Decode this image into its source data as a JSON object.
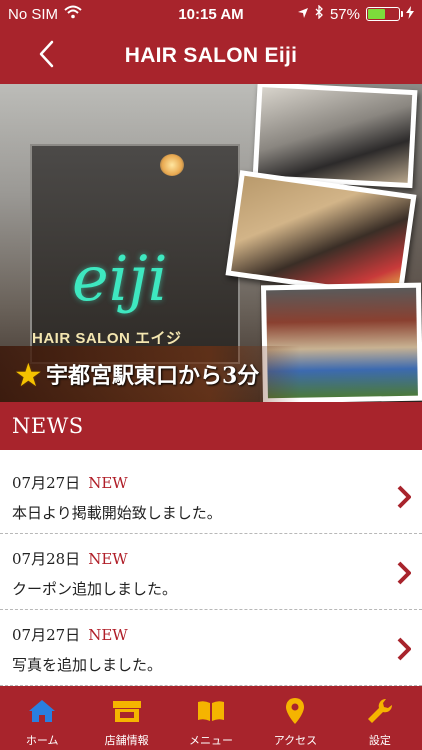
{
  "status_bar": {
    "carrier": "No SIM",
    "time": "10:15 AM",
    "battery_percent": "57%",
    "battery_level": 0.57
  },
  "nav": {
    "title": "HAIR SALON Eiji",
    "back_icon": "chevron-left-icon"
  },
  "hero": {
    "logo_text": "eiji",
    "sign_text": "HAIR SALON エイジ",
    "caption": "宇都宮駅東口から3分",
    "star_icon": "star-icon"
  },
  "news": {
    "header": "NEWS",
    "items": [
      {
        "date": "07月27日",
        "badge": "NEW",
        "text": "本日より掲載開始致しました。"
      },
      {
        "date": "07月28日",
        "badge": "NEW",
        "text": "クーポン追加しました。"
      },
      {
        "date": "07月27日",
        "badge": "NEW",
        "text": "写真を追加しました。"
      }
    ]
  },
  "tabs": [
    {
      "label": "ホーム",
      "icon": "home-icon",
      "color": "#2a7fe0"
    },
    {
      "label": "店舗情報",
      "icon": "shop-icon",
      "color": "#f5b400"
    },
    {
      "label": "メニュー",
      "icon": "book-icon",
      "color": "#f5b400"
    },
    {
      "label": "アクセス",
      "icon": "map-pin-icon",
      "color": "#f5b400"
    },
    {
      "label": "設定",
      "icon": "wrench-icon",
      "color": "#f5b400"
    }
  ],
  "colors": {
    "brand": "#a8242c",
    "badge": "#b01e28",
    "active_tab": "#2a7fe0",
    "tab_icon": "#f5b400"
  }
}
